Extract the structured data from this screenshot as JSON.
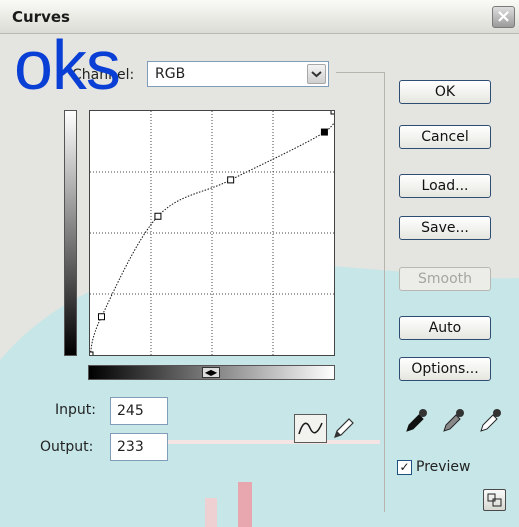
{
  "window": {
    "title": "Curves",
    "close_icon": "close-icon"
  },
  "watermark": {
    "text": "oks"
  },
  "channel": {
    "label": "Channel:",
    "value": "RGB"
  },
  "input": {
    "label": "Input:",
    "value": "245"
  },
  "output": {
    "label": "Output:",
    "value": "233"
  },
  "buttons": {
    "ok": "OK",
    "cancel": "Cancel",
    "load": "Load...",
    "save": "Save...",
    "smooth": "Smooth",
    "auto": "Auto",
    "options": "Options..."
  },
  "preview": {
    "label": "Preview",
    "checked": true
  },
  "curve": {
    "control_points_input": [
      0,
      12,
      71,
      147,
      245,
      255
    ],
    "control_points_output": [
      0,
      40,
      145,
      183,
      233,
      255
    ],
    "selected_point": 4
  },
  "icons": [
    "curve-tool-icon",
    "pencil-icon",
    "black-eyedropper-icon",
    "gray-eyedropper-icon",
    "white-eyedropper-icon",
    "expand-icon",
    "chevron-down-icon"
  ],
  "colors": {
    "accent": "#0a3fd6",
    "bg_shape": "#c6e6e8",
    "button_border": "#2f4c73"
  }
}
